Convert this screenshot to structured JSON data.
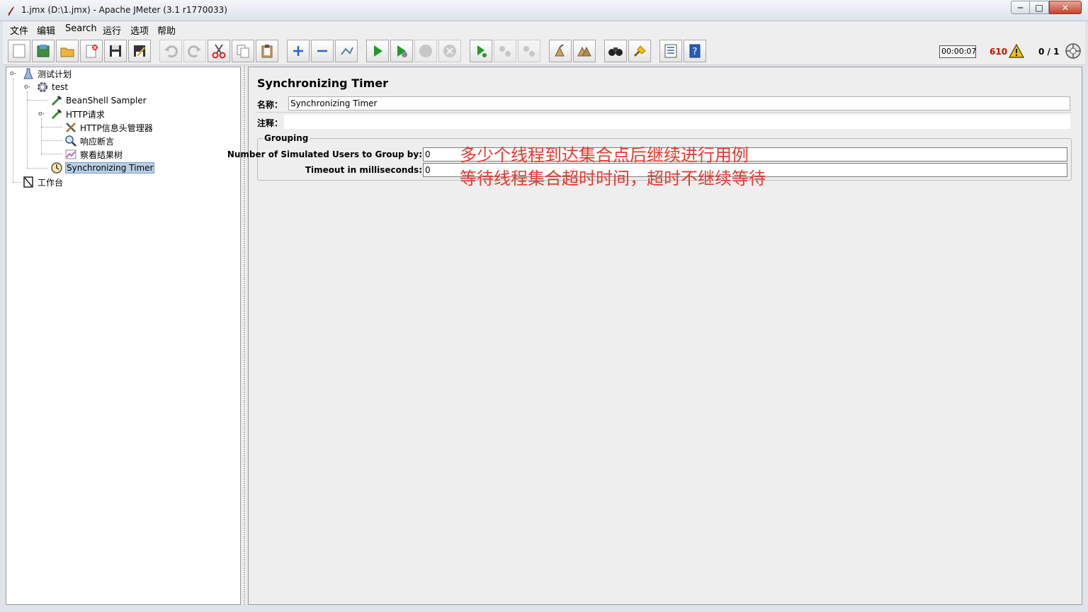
{
  "window": {
    "title": "1.jmx (D:\\1.jmx) - Apache JMeter (3.1 r1770033)",
    "controls": {
      "minimize": "─",
      "maximize": "□",
      "close": "✕"
    }
  },
  "menu": [
    "文件",
    "编辑",
    "Search",
    "运行",
    "选项",
    "帮助"
  ],
  "toolbar": {
    "buttons": [
      {
        "icon": "new-icon"
      },
      {
        "icon": "templates-icon"
      },
      {
        "icon": "open-icon"
      },
      {
        "icon": "close-file-icon"
      },
      {
        "icon": "save-icon"
      },
      {
        "icon": "save-as-icon"
      },
      {
        "icon": "undo-icon"
      },
      {
        "icon": "redo-icon"
      },
      {
        "icon": "cut-icon"
      },
      {
        "icon": "copy-icon"
      },
      {
        "icon": "paste-icon"
      },
      {
        "icon": "expand-icon"
      },
      {
        "icon": "collapse-icon"
      },
      {
        "icon": "toggle-icon"
      },
      {
        "icon": "start-icon"
      },
      {
        "icon": "start-no-pause-icon"
      },
      {
        "icon": "stop-icon"
      },
      {
        "icon": "shutdown-icon"
      },
      {
        "icon": "remote-start-icon"
      },
      {
        "icon": "remote-stop-icon"
      },
      {
        "icon": "remote-shutdown-icon"
      },
      {
        "icon": "clear-icon"
      },
      {
        "icon": "clear-all-icon"
      },
      {
        "icon": "search-icon"
      },
      {
        "icon": "reset-search-icon"
      },
      {
        "icon": "function-helper-icon"
      },
      {
        "icon": "help-icon"
      }
    ],
    "elapsed_time": "00:00:07",
    "error_count": "610",
    "threads": "0 / 1",
    "colors": {
      "error": "#e00000",
      "warning": "#f2c200"
    }
  },
  "tree": {
    "nodes": [
      {
        "label": "测试计划",
        "icon": "test-plan-icon"
      },
      {
        "label": "test",
        "icon": "thread-group-gear-icon"
      },
      {
        "label": "BeanShell Sampler",
        "icon": "sampler-pipette-icon"
      },
      {
        "label": "HTTP请求",
        "icon": "sampler-pipette-icon"
      },
      {
        "label": "HTTP信息头管理器",
        "icon": "config-tools-icon"
      },
      {
        "label": "响应断言",
        "icon": "assertion-magnifier-icon"
      },
      {
        "label": "察看结果树",
        "icon": "listener-graph-icon"
      },
      {
        "label": "Synchronizing Timer",
        "icon": "timer-clock-icon",
        "selected": true
      },
      {
        "label": "工作台",
        "icon": "workbench-icon"
      }
    ]
  },
  "editor": {
    "title": "Synchronizing Timer",
    "name_label": "名称：",
    "name_value": "Synchronizing Timer",
    "comment_label": "注释：",
    "comment_value": "",
    "grouping": {
      "legend": "Grouping",
      "users_label": "Number of Simulated Users to Group by:",
      "users_value": "0",
      "timeout_label": "Timeout in milliseconds:",
      "timeout_value": "0"
    },
    "annotations": {
      "line1": "多少个线程到达集合点后继续进行用例",
      "line2": "等待线程集合超时时间，超时不继续等待",
      "color": "#e8382c"
    }
  }
}
